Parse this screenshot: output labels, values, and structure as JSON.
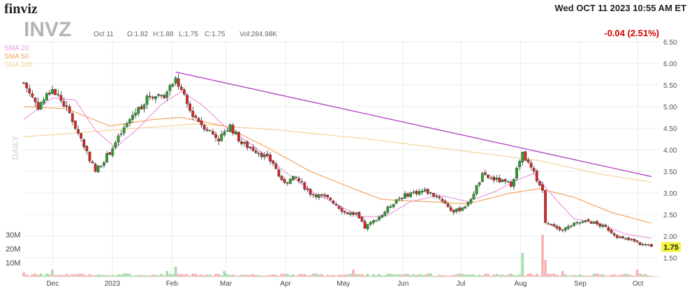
{
  "header": {
    "logo": "finviz",
    "timestamp": "Wed OCT 11 2023 10:55 AM ET"
  },
  "chart_data": {
    "type": "candlestick",
    "ticker": "INVZ",
    "period_label": "DAILY",
    "ohlc_info": {
      "date": "Oct 11",
      "open": "O:1.82",
      "high": "H:1.88",
      "low": "L:1.75",
      "close": "C:1.75",
      "volume": "Vol:284.98K"
    },
    "change_text": "-0.04 (2.51%)",
    "last_price_label": "1.75",
    "colors": {
      "up": "#2ca02c",
      "down": "#d62728",
      "sma20": "#ee99dd",
      "sma50": "#f5a55e",
      "sma200": "#f2d49a",
      "trendline": "#b43cc4",
      "price_tag": "#f3f33c",
      "vol_up": "#a8dca8",
      "vol_down": "#f4b4b4"
    },
    "legend": [
      "SMA 20",
      "SMA 50",
      "SMA 200"
    ],
    "y_ticks": [
      "6.50",
      "6.00",
      "5.50",
      "5.00",
      "4.50",
      "4.00",
      "3.50",
      "3.00",
      "2.50",
      "2.00",
      "1.50"
    ],
    "ylim": [
      1.3,
      6.5
    ],
    "volume_ticks": [
      "30M",
      "20M",
      "10M"
    ],
    "x_labels": [
      "Dec",
      "2023",
      "Feb",
      "Mar",
      "Apr",
      "May",
      "Jun",
      "Jul",
      "Aug",
      "Sep",
      "Oct"
    ],
    "x_label_days": [
      15,
      46,
      77,
      105,
      136,
      166,
      197,
      227,
      258,
      289,
      319
    ],
    "day_range": [
      0,
      330
    ],
    "close_anchors": [
      [
        0,
        5.55
      ],
      [
        5,
        5.0
      ],
      [
        10,
        5.42
      ],
      [
        15,
        4.95
      ],
      [
        20,
        4.25
      ],
      [
        25,
        3.5
      ],
      [
        30,
        3.95
      ],
      [
        38,
        4.8
      ],
      [
        44,
        5.25
      ],
      [
        50,
        5.3
      ],
      [
        53,
        5.65
      ],
      [
        58,
        4.9
      ],
      [
        62,
        4.6
      ],
      [
        68,
        4.25
      ],
      [
        72,
        4.55
      ],
      [
        76,
        4.15
      ],
      [
        82,
        3.95
      ],
      [
        87,
        3.7
      ],
      [
        90,
        3.25
      ],
      [
        95,
        3.35
      ],
      [
        100,
        3.0
      ],
      [
        107,
        2.85
      ],
      [
        112,
        2.55
      ],
      [
        116,
        2.5
      ],
      [
        119,
        2.2
      ],
      [
        125,
        2.5
      ],
      [
        130,
        2.85
      ],
      [
        135,
        3.0
      ],
      [
        140,
        3.05
      ],
      [
        145,
        2.9
      ],
      [
        150,
        2.55
      ],
      [
        155,
        2.75
      ],
      [
        160,
        3.4
      ],
      [
        165,
        3.3
      ],
      [
        170,
        3.2
      ],
      [
        174,
        3.9
      ],
      [
        178,
        3.45
      ],
      [
        181,
        3.05
      ],
      [
        182,
        2.35
      ],
      [
        188,
        2.15
      ],
      [
        193,
        2.3
      ],
      [
        197,
        2.35
      ],
      [
        203,
        2.2
      ],
      [
        208,
        1.95
      ],
      [
        212,
        1.9
      ],
      [
        216,
        1.8
      ],
      [
        219,
        1.75
      ]
    ],
    "sma20_anchors": [
      [
        0,
        4.7
      ],
      [
        10,
        5.2
      ],
      [
        18,
        5.15
      ],
      [
        25,
        4.45
      ],
      [
        32,
        4.05
      ],
      [
        40,
        4.5
      ],
      [
        48,
        5.05
      ],
      [
        55,
        5.35
      ],
      [
        62,
        5.05
      ],
      [
        70,
        4.55
      ],
      [
        80,
        4.1
      ],
      [
        90,
        3.55
      ],
      [
        100,
        3.05
      ],
      [
        110,
        2.7
      ],
      [
        118,
        2.45
      ],
      [
        126,
        2.45
      ],
      [
        135,
        2.8
      ],
      [
        145,
        2.95
      ],
      [
        155,
        2.8
      ],
      [
        165,
        3.05
      ],
      [
        172,
        3.3
      ],
      [
        178,
        3.45
      ],
      [
        185,
        2.9
      ],
      [
        192,
        2.4
      ],
      [
        200,
        2.3
      ],
      [
        210,
        2.05
      ],
      [
        219,
        1.95
      ]
    ],
    "sma50_anchors": [
      [
        0,
        5.0
      ],
      [
        15,
        4.95
      ],
      [
        30,
        4.55
      ],
      [
        45,
        4.7
      ],
      [
        55,
        4.75
      ],
      [
        70,
        4.55
      ],
      [
        85,
        4.05
      ],
      [
        100,
        3.5
      ],
      [
        115,
        3.1
      ],
      [
        125,
        2.85
      ],
      [
        140,
        2.8
      ],
      [
        155,
        2.75
      ],
      [
        170,
        3.0
      ],
      [
        180,
        3.1
      ],
      [
        192,
        2.9
      ],
      [
        205,
        2.55
      ],
      [
        219,
        2.3
      ]
    ],
    "sma200_anchors": [
      [
        0,
        4.3
      ],
      [
        30,
        4.45
      ],
      [
        60,
        4.6
      ],
      [
        90,
        4.45
      ],
      [
        120,
        4.25
      ],
      [
        150,
        4.0
      ],
      [
        180,
        3.75
      ],
      [
        200,
        3.45
      ],
      [
        219,
        3.25
      ]
    ],
    "trendline": {
      "from_day": 53,
      "from_price": 5.8,
      "to_day": 219,
      "to_price": 3.38
    },
    "volume_spikes": [
      [
        0,
        3
      ],
      [
        10,
        5
      ],
      [
        50,
        4
      ],
      [
        53,
        7
      ],
      [
        70,
        4
      ],
      [
        115,
        5
      ],
      [
        174,
        17
      ],
      [
        181,
        30
      ],
      [
        182,
        12
      ],
      [
        188,
        4
      ],
      [
        214,
        5
      ]
    ]
  }
}
